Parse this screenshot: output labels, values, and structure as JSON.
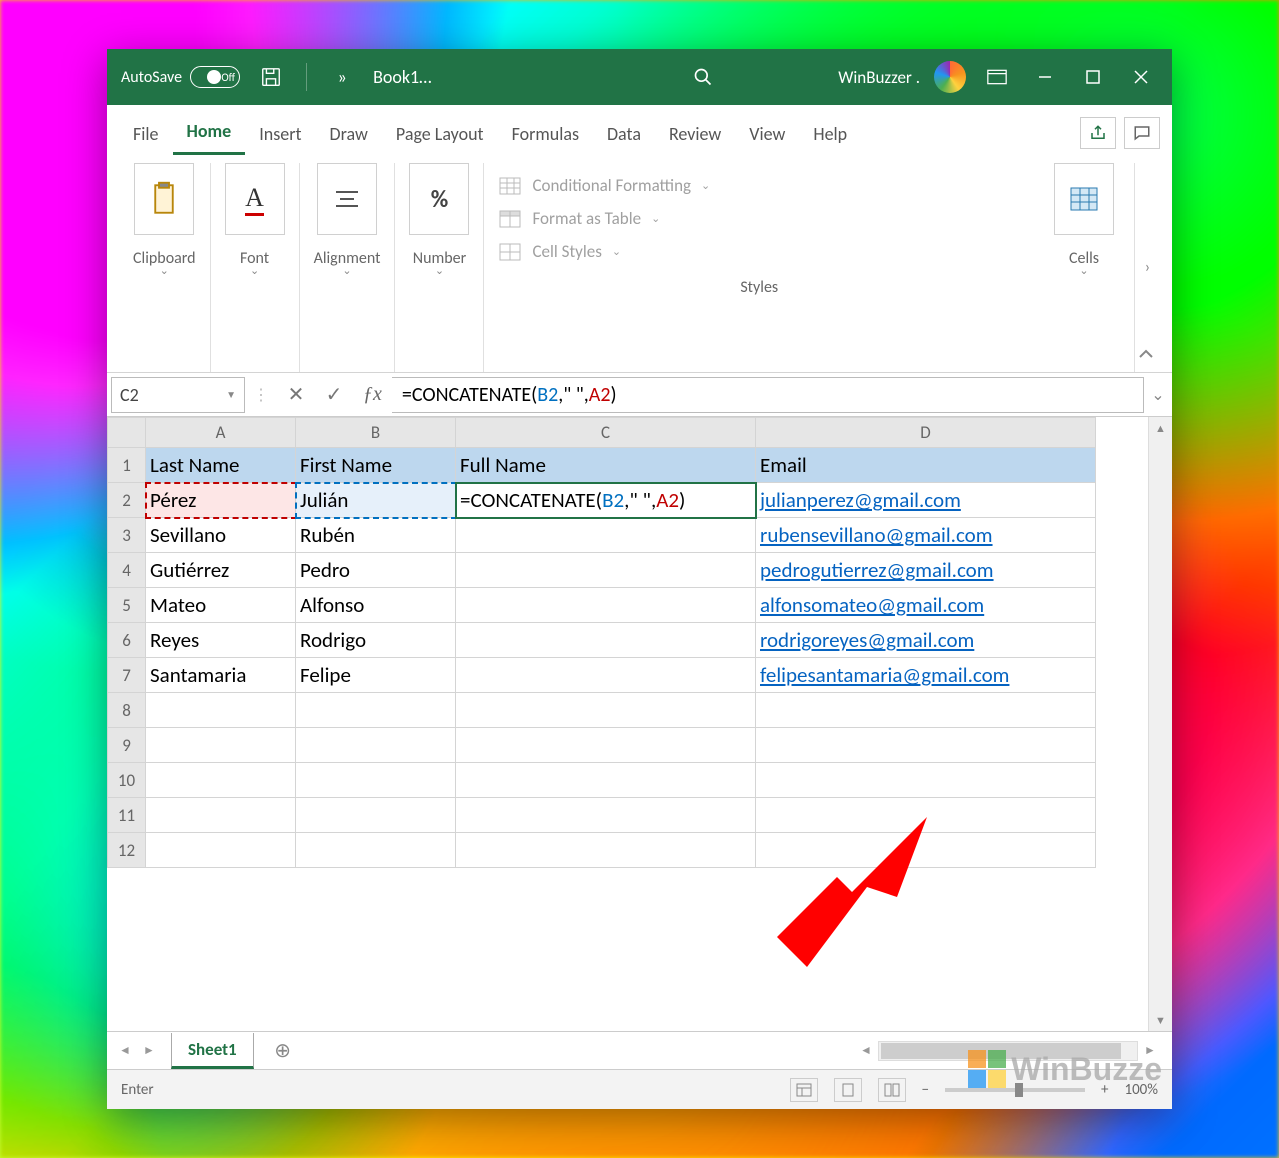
{
  "titlebar": {
    "autosave_label": "AutoSave",
    "autosave_state": "Off",
    "file_title": "Book1…",
    "user_name": "WinBuzzer ."
  },
  "menu": {
    "items": [
      "File",
      "Home",
      "Insert",
      "Draw",
      "Page Layout",
      "Formulas",
      "Data",
      "Review",
      "View",
      "Help"
    ],
    "active_index": 1
  },
  "ribbon": {
    "clipboard": "Clipboard",
    "font": "Font",
    "alignment": "Alignment",
    "number": "Number",
    "cond_fmt": "Conditional Formatting",
    "fmt_table": "Format as Table",
    "cell_styles": "Cell Styles",
    "styles_label": "Styles",
    "cells": "Cells"
  },
  "formula_bar": {
    "name_box": "C2",
    "formula_prefix": "=CONCATENATE(",
    "ref1": "B2",
    "mid": ",\" \",",
    "ref2": "A2",
    "suffix": ")"
  },
  "grid": {
    "columns": [
      "A",
      "B",
      "C",
      "D"
    ],
    "headers": {
      "A": "Last Name",
      "B": "First Name",
      "C": "Full Name",
      "D": "Email"
    },
    "cell_c2_prefix": "=CONCATENATE(",
    "cell_c2_ref1": "B2",
    "cell_c2_mid": ",\" \",",
    "cell_c2_ref2": "A2",
    "cell_c2_suffix": ")",
    "rows": [
      {
        "n": 2,
        "A": "Pérez",
        "B": "Julián",
        "D": "julianperez@gmail.com"
      },
      {
        "n": 3,
        "A": "Sevillano",
        "B": "Rubén",
        "D": "rubensevillano@gmail.com"
      },
      {
        "n": 4,
        "A": "Gutiérrez",
        "B": "Pedro",
        "D": "pedrogutierrez@gmail.com"
      },
      {
        "n": 5,
        "A": "Mateo",
        "B": "Alfonso",
        "D": "alfonsomateo@gmail.com"
      },
      {
        "n": 6,
        "A": "Reyes",
        "B": "Rodrigo",
        "D": "rodrigoreyes@gmail.com"
      },
      {
        "n": 7,
        "A": "Santamaria",
        "B": "Felipe",
        "D": "felipesantamaria@gmail.com"
      }
    ],
    "empty_rows": [
      8,
      9,
      10,
      11,
      12
    ],
    "col_widths": {
      "rowhdr": 38,
      "A": 150,
      "B": 160,
      "C": 300,
      "D": 340
    }
  },
  "sheet_tabs": {
    "active": "Sheet1"
  },
  "statusbar": {
    "mode": "Enter",
    "zoom": "100%"
  },
  "watermark": "WinBuzze"
}
